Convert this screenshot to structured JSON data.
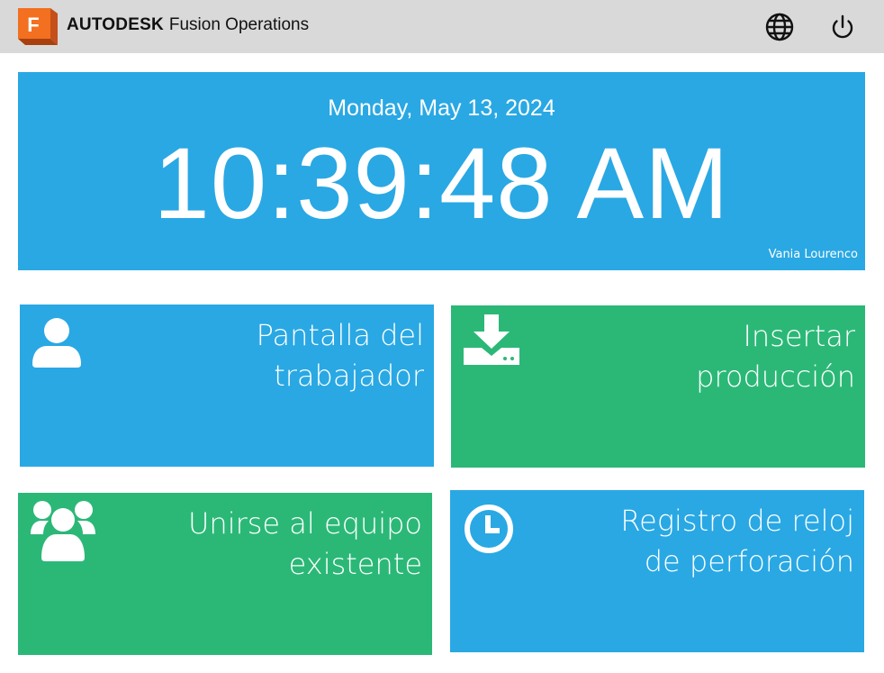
{
  "header": {
    "brand_bold": "AUTODESK",
    "brand_light": "Fusion Operations",
    "logo_letter": "F",
    "logo_icon": "autodesk-fusion-logo",
    "language_icon": "globe-icon",
    "power_icon": "power-icon"
  },
  "clock": {
    "date": "Monday, May 13, 2024",
    "time": "10:39:48 AM",
    "user": "Vania Lourenco"
  },
  "tiles": [
    {
      "line1": "Pantalla del",
      "line2": "trabajador",
      "icon": "user-icon",
      "color": "#29a8e4"
    },
    {
      "line1": "Insertar",
      "line2": "producción",
      "icon": "download-tray-icon",
      "color": "#2bb877"
    },
    {
      "line1": "Unirse al equipo",
      "line2": "existente",
      "icon": "team-icon",
      "color": "#2bb877"
    },
    {
      "line1": "Registro de reloj",
      "line2": "de perforación",
      "icon": "clock-icon",
      "color": "#29a8e4"
    }
  ],
  "colors": {
    "header_bg": "#d9d9d9",
    "blue": "#29a8e4",
    "green": "#2bb877",
    "logo_orange": "#f37021"
  }
}
